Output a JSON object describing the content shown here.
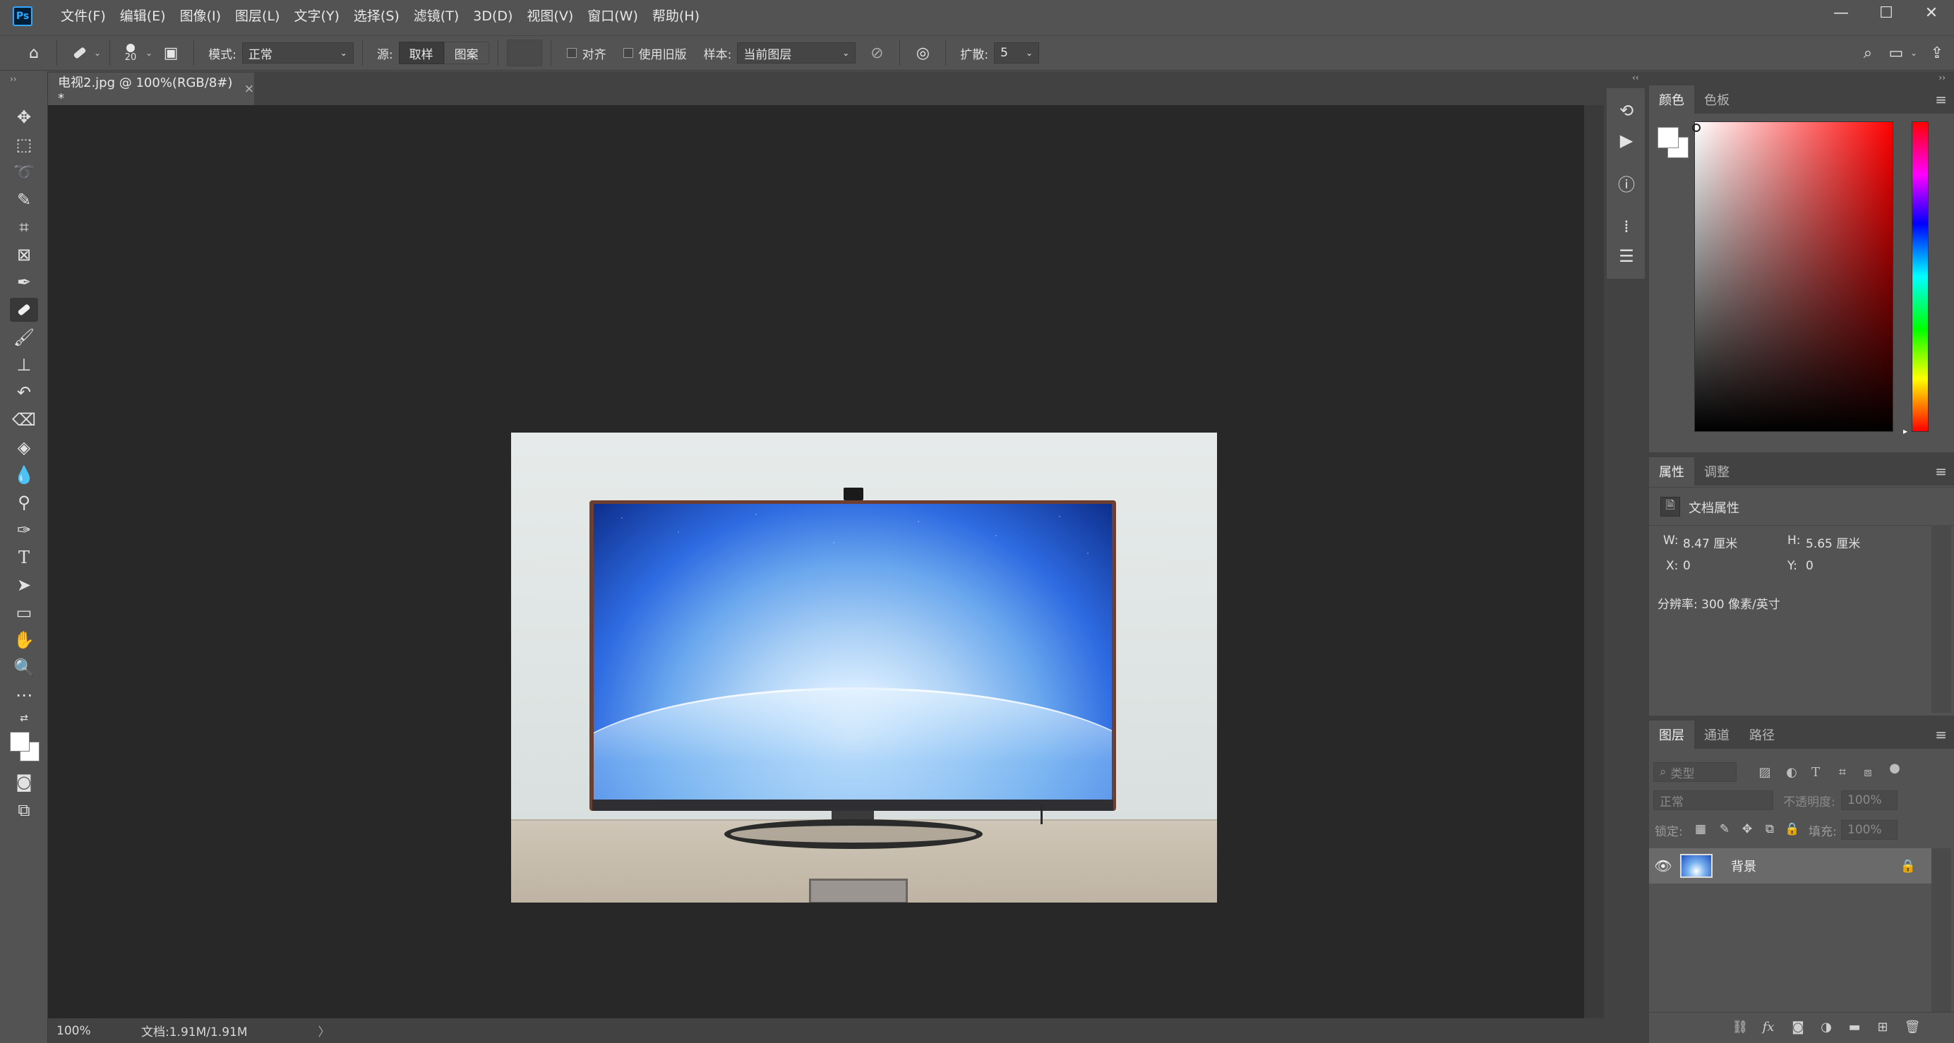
{
  "menubar": {
    "app_logo": "Ps",
    "items": [
      "文件(F)",
      "编辑(E)",
      "图像(I)",
      "图层(L)",
      "文字(Y)",
      "选择(S)",
      "滤镜(T)",
      "3D(D)",
      "视图(V)",
      "窗口(W)",
      "帮助(H)"
    ],
    "window_controls": {
      "minimize": "—",
      "maximize": "☐",
      "close": "✕"
    }
  },
  "options": {
    "brush_size": "20",
    "mode_label": "模式:",
    "mode_value": "正常",
    "source_label": "源:",
    "source_sampled": "取样",
    "source_pattern": "图案",
    "aligned_label": "对齐",
    "legacy_label": "使用旧版",
    "sample_label": "样本:",
    "sample_value": "当前图层",
    "diffusion_label": "扩散:",
    "diffusion_value": "5"
  },
  "document": {
    "tab_title": "电视2.jpg @ 100%(RGB/8#) *",
    "tab_close": "×",
    "zoom": "100%",
    "doc_info": "文档:1.91M/1.91M",
    "status_arrow": "〉"
  },
  "color_panel": {
    "tabs": [
      "颜色",
      "色板"
    ],
    "fg_color": "#ffffff",
    "bg_color": "#ffffff"
  },
  "properties_panel": {
    "tabs": [
      "属性",
      "调整"
    ],
    "section_title": "文档属性",
    "w_label": "W:",
    "w_value": "8.47 厘米",
    "h_label": "H:",
    "h_value": "5.65 厘米",
    "x_label": "X:",
    "x_value": "0",
    "y_label": "Y:",
    "y_value": "0",
    "resolution": "分辨率: 300 像素/英寸"
  },
  "layers_panel": {
    "tabs": [
      "图层",
      "通道",
      "路径"
    ],
    "filter_placeholder": "类型",
    "blend_mode": "正常",
    "opacity_label": "不透明度:",
    "opacity_value": "100%",
    "lock_label": "锁定:",
    "fill_label": "填充:",
    "fill_value": "100%",
    "layers": [
      {
        "name": "背景",
        "visible": true,
        "locked": true
      }
    ]
  },
  "icons": {
    "toolbar": [
      "move-icon",
      "marquee-icon",
      "lasso-icon",
      "quick-select-icon",
      "crop-icon",
      "frame-icon",
      "eyedropper-icon",
      "healing-brush-icon",
      "brush-icon",
      "stamp-icon",
      "history-brush-icon",
      "eraser-icon",
      "paint-bucket-icon",
      "blur-icon",
      "dodge-icon",
      "pen-icon",
      "type-icon",
      "path-select-icon",
      "rectangle-icon",
      "hand-icon",
      "zoom-icon",
      "more-tools-icon"
    ]
  }
}
